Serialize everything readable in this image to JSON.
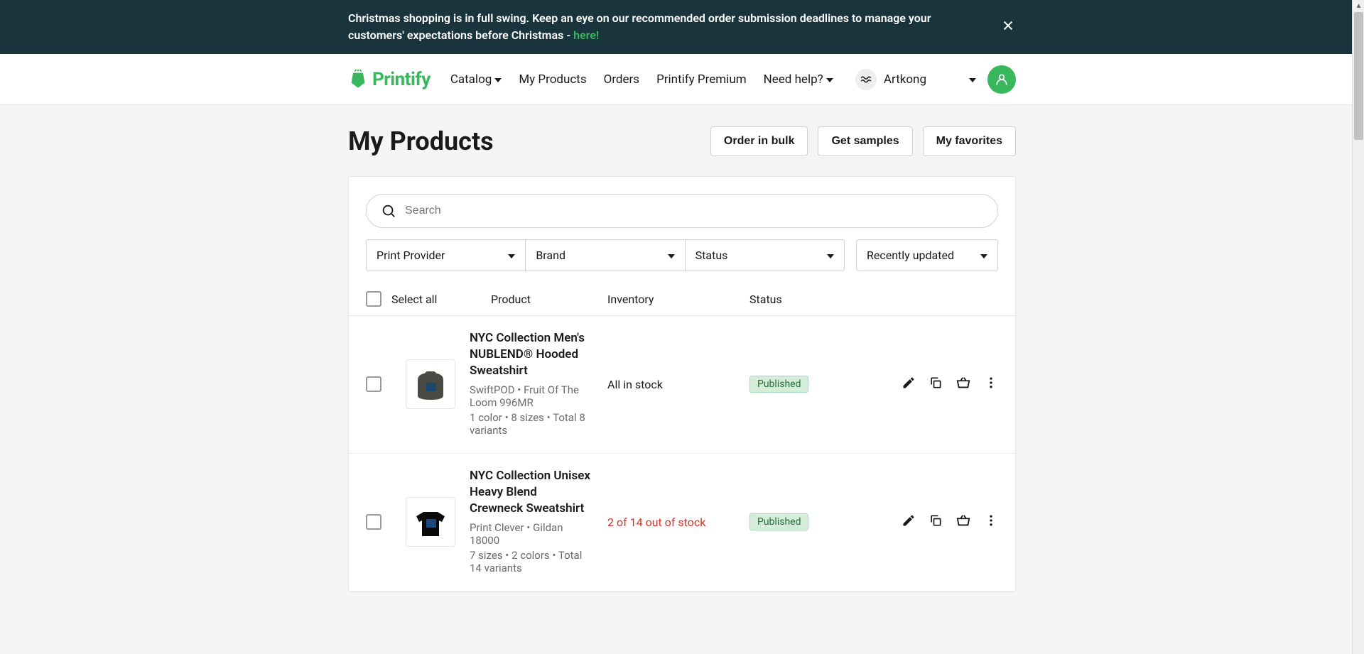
{
  "banner": {
    "text_pre": "Christmas shopping is in full swing. Keep an eye on our recommended order submission deadlines to manage your customers' expectations before Christmas - ",
    "link_text": "here!"
  },
  "nav": {
    "catalog": "Catalog",
    "my_products": "My Products",
    "orders": "Orders",
    "premium": "Printify Premium",
    "need_help": "Need help?"
  },
  "logo_text": "Printify",
  "store_name": "Artkong",
  "page": {
    "title": "My Products",
    "order_bulk": "Order in bulk",
    "get_samples": "Get samples",
    "my_favorites": "My favorites"
  },
  "search": {
    "placeholder": "Search"
  },
  "filters": {
    "print_provider": "Print Provider",
    "brand": "Brand",
    "status": "Status",
    "sort": "Recently updated"
  },
  "table": {
    "select_all": "Select all",
    "product_header": "Product",
    "inventory_header": "Inventory",
    "status_header": "Status"
  },
  "products": [
    {
      "name": "NYC Collection Men's NUBLEND® Hooded Sweatshirt",
      "meta1": "SwiftPOD • Fruit Of The Loom 996MR",
      "meta2": "1 color • 8 sizes • Total 8 variants",
      "inventory": "All in stock",
      "inventory_warn": false,
      "status": "Published"
    },
    {
      "name": "NYC Collection Unisex Heavy Blend Crewneck Sweatshirt",
      "meta1": "Print Clever • Gildan 18000",
      "meta2": "7 sizes • 2 colors • Total 14 variants",
      "inventory": "2 of 14 out of stock",
      "inventory_warn": true,
      "status": "Published"
    }
  ]
}
